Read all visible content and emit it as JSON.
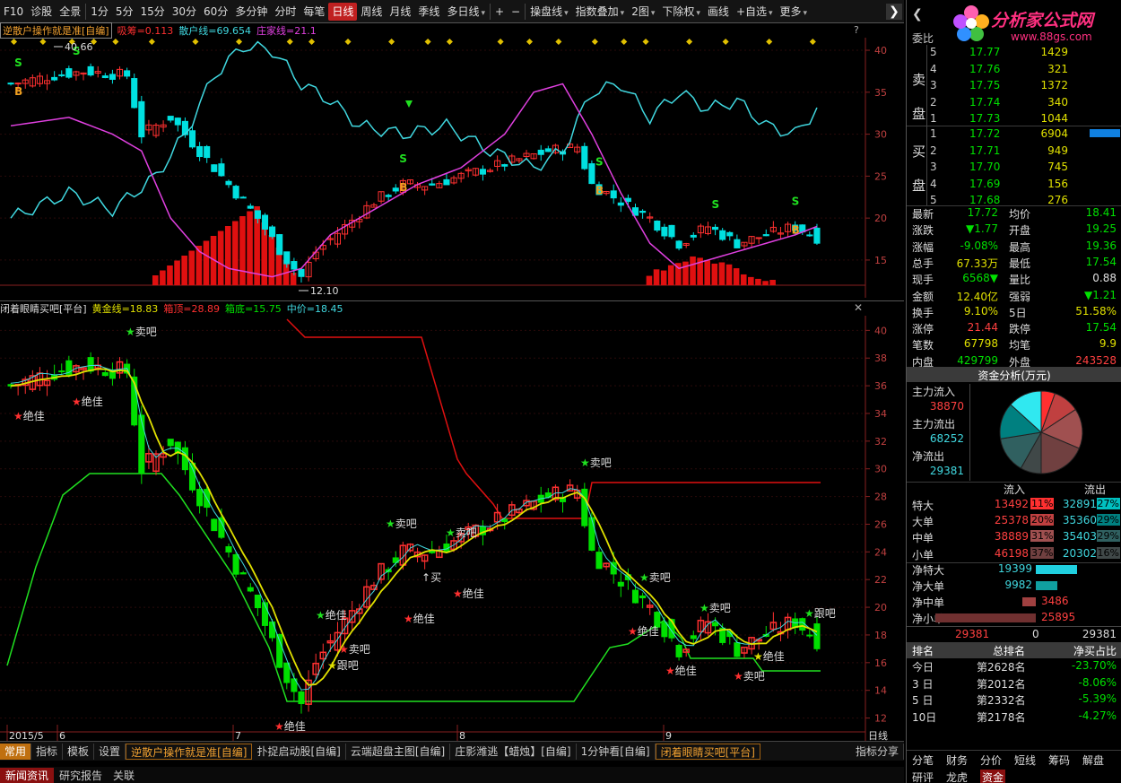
{
  "toolbar": {
    "items": [
      {
        "label": "F10",
        "active": false
      },
      {
        "label": "诊股",
        "active": false
      },
      {
        "label": "全景",
        "active": false
      },
      {
        "label": "1分",
        "active": false
      },
      {
        "label": "5分",
        "active": false
      },
      {
        "label": "15分",
        "active": false
      },
      {
        "label": "30分",
        "active": false
      },
      {
        "label": "60分",
        "active": false
      },
      {
        "label": "多分钟",
        "active": false
      },
      {
        "label": "分时",
        "active": false
      },
      {
        "label": "每笔",
        "active": false
      },
      {
        "label": "日线",
        "active": true
      },
      {
        "label": "周线",
        "active": false
      },
      {
        "label": "月线",
        "active": false
      },
      {
        "label": "季线",
        "active": false
      },
      {
        "label": "多日线",
        "active": false,
        "dropdown": true
      },
      {
        "label": "+",
        "active": false
      },
      {
        "label": "−",
        "active": false
      },
      {
        "label": "操盘线",
        "active": false,
        "dropdown": true
      },
      {
        "label": "指数叠加",
        "active": false,
        "dropdown": true
      },
      {
        "label": "2图",
        "active": false,
        "dropdown": true
      },
      {
        "label": "下除权",
        "active": false,
        "dropdown": true
      },
      {
        "label": "画线",
        "active": false
      },
      {
        "label": "+自选",
        "active": false,
        "dropdown": true
      },
      {
        "label": "更多",
        "active": false,
        "dropdown": true
      }
    ]
  },
  "upper": {
    "formula": "逆散户操作就是准[自编]",
    "i1": "吸筹=0.113",
    "i2": "散户线=69.654",
    "i3": "庄家线=21.1",
    "yaxis": [
      "40",
      "35",
      "30",
      "25",
      "20",
      "15"
    ],
    "label_high": "40.66",
    "label_low": "12.10",
    "sig_s": "S",
    "sig_b": "B",
    "help": "?"
  },
  "lower": {
    "formula": "闭着眼睛买吧[平台]",
    "i1": "黄金线=18.83",
    "i2": "箱顶=28.89",
    "i3": "箱底=15.75",
    "i4": "中价=18.45",
    "close": "✕",
    "yaxis": [
      "40",
      "38",
      "36",
      "34",
      "32",
      "30",
      "28",
      "26",
      "24",
      "22",
      "20",
      "18",
      "16",
      "14",
      "12"
    ],
    "labels": [
      "绝佳",
      "绝佳",
      "卖吧",
      "卖吧",
      "跟吧",
      "绝佳",
      "卖吧",
      "绝佳",
      "卖吧",
      "买",
      "卖吧",
      "绝佳",
      "卖吧",
      "绝佳",
      "绝佳",
      "卖吧",
      "跟吧",
      "绝佳",
      "卖吧",
      "绝佳"
    ],
    "xaxis": [
      "2015/5",
      "6",
      "7",
      "8",
      "9"
    ],
    "period": "日线"
  },
  "bottombar": {
    "changyong": "常用",
    "zhibiao": "指标",
    "moban": "模板",
    "shezhi": "设置",
    "tabs": [
      "逆散户操作就是准[自编]",
      "扑捉启动股[自编]",
      "云端超盘主图[自编]",
      "庄影潍逃【蜡烛】[自编]",
      "1分钟看[自编]",
      "闭着眼睛买吧[平台]"
    ],
    "share": "指标分享"
  },
  "newsbar": {
    "tabs": [
      "新闻资讯",
      "研究报告",
      "关联"
    ]
  },
  "right": {
    "watermark": {
      "title": "分析家公式网",
      "url": "www.88gs.com"
    },
    "weibi": "委比",
    "sell_label": [
      "卖",
      "盘"
    ],
    "buy_label": [
      "买",
      "盘"
    ],
    "asks": [
      {
        "n": "5",
        "p": "17.77",
        "v": "1429"
      },
      {
        "n": "4",
        "p": "17.76",
        "v": "321"
      },
      {
        "n": "3",
        "p": "17.75",
        "v": "1372"
      },
      {
        "n": "2",
        "p": "17.74",
        "v": "340"
      },
      {
        "n": "1",
        "p": "17.73",
        "v": "1044"
      }
    ],
    "bids": [
      {
        "n": "1",
        "p": "17.72",
        "v": "6904"
      },
      {
        "n": "2",
        "p": "17.71",
        "v": "949"
      },
      {
        "n": "3",
        "p": "17.70",
        "v": "745"
      },
      {
        "n": "4",
        "p": "17.69",
        "v": "156"
      },
      {
        "n": "5",
        "p": "17.68",
        "v": "276"
      }
    ],
    "stats": [
      {
        "l1": "最新",
        "v1": "17.72",
        "l2": "均价",
        "v2": "18.41",
        "c1": "#00e000",
        "c2": "#00e000"
      },
      {
        "l1": "涨跌",
        "v1": "▼1.77",
        "l2": "开盘",
        "v2": "19.25",
        "c1": "#00e000",
        "c2": "#00e000"
      },
      {
        "l1": "涨幅",
        "v1": "-9.08%",
        "l2": "最高",
        "v2": "19.36",
        "c1": "#00e000",
        "c2": "#00e000"
      },
      {
        "l1": "总手",
        "v1": "67.33万",
        "l2": "最低",
        "v2": "17.54",
        "c1": "#e0e000",
        "c2": "#00e000"
      },
      {
        "l1": "现手",
        "v1": "6568▼",
        "l2": "量比",
        "v2": "0.88",
        "c1": "#00e000",
        "c2": "#e0e0e0"
      },
      {
        "l1": "金额",
        "v1": "12.40亿",
        "l2": "强弱",
        "v2": "▼1.21",
        "c1": "#e0e000",
        "c2": "#00e000"
      },
      {
        "l1": "换手",
        "v1": "9.10%",
        "l2": "5日",
        "v2": "51.58%",
        "c1": "#e0e000",
        "c2": "#e0e000"
      },
      {
        "l1": "涨停",
        "v1": "21.44",
        "l2": "跌停",
        "v2": "17.54",
        "c1": "#ff4040",
        "c2": "#00e000"
      },
      {
        "l1": "笔数",
        "v1": "67798",
        "l2": "均笔",
        "v2": "9.9",
        "c1": "#e0e000",
        "c2": "#e0e000"
      },
      {
        "l1": "内盘",
        "v1": "429799",
        "l2": "外盘",
        "v2": "243528",
        "c1": "#00e000",
        "c2": "#ff4040"
      }
    ],
    "funds_title": "资金分析(万元)",
    "flow": [
      {
        "l": "主力流入",
        "v": "38870"
      },
      {
        "l": "主力流出",
        "v": "68252"
      },
      {
        "l": "净流出",
        "v": "29381"
      }
    ],
    "flow_head": [
      "流入",
      "流出"
    ],
    "flow_rows": [
      {
        "l": "特大",
        "in": "13492",
        "ip": "11%",
        "out": "32891",
        "op": "27%",
        "ic": "#ff3030",
        "oc": "#00c0c0"
      },
      {
        "l": "大单",
        "in": "25378",
        "ip": "20%",
        "out": "35360",
        "op": "29%",
        "ic": "#c04040",
        "oc": "#008080"
      },
      {
        "l": "中单",
        "in": "38889",
        "ip": "31%",
        "out": "35403",
        "op": "29%",
        "ic": "#a05050",
        "oc": "#306060"
      },
      {
        "l": "小单",
        "in": "46198",
        "ip": "37%",
        "out": "20302",
        "op": "16%",
        "ic": "#704040",
        "oc": "#404848"
      }
    ],
    "net": [
      {
        "l": "净特大",
        "v": "19399",
        "frac": 0.75,
        "c": "#20d0e0",
        "neg": true
      },
      {
        "l": "净大单",
        "v": "9982",
        "frac": 0.39,
        "c": "#10a0a0",
        "neg": true
      },
      {
        "l": "净中单",
        "v": "3486",
        "frac": 0.13,
        "c": "#a04040",
        "neg": false
      },
      {
        "l": "净小单",
        "v": "25895",
        "frac": 1.0,
        "c": "#703030",
        "neg": false
      }
    ],
    "net_total": [
      "29381",
      "0",
      "29381"
    ],
    "rank_head": [
      "排名",
      "总排名",
      "净买占比"
    ],
    "ranks": [
      {
        "l": "今日",
        "r": "第2628名",
        "p": "-23.70%"
      },
      {
        "l": "3 日",
        "r": "第2012名",
        "p": "-8.06%"
      },
      {
        "l": "5 日",
        "r": "第2332名",
        "p": "-5.39%"
      },
      {
        "l": "10日",
        "r": "第2178名",
        "p": "-4.27%"
      }
    ],
    "btabs1": [
      "分笔",
      "财务",
      "分价",
      "短线",
      "筹码",
      "解盘"
    ],
    "btabs2": [
      "研评",
      "龙虎",
      "资金"
    ]
  },
  "colors": {
    "up": "#ff3030",
    "down": "#00e0e0",
    "green": "#00e000",
    "yellow": "#e0e000",
    "magenta": "#e040e0",
    "cyan": "#40d8e0",
    "boxred": "#e01010",
    "boxgreen": "#20c020",
    "lime": "#20e020"
  }
}
